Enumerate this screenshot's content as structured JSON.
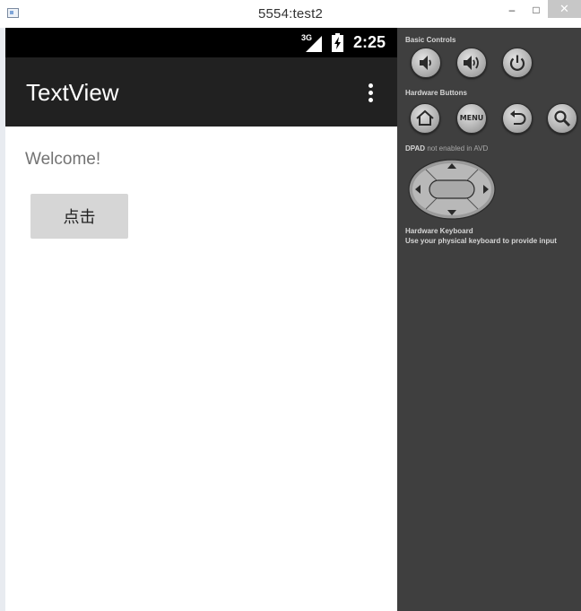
{
  "window": {
    "title": "5554:test2",
    "minimize_glyph": "–",
    "maximize_glyph": "□",
    "close_glyph": "✕"
  },
  "statusbar": {
    "network_label": "3G",
    "time": "2:25"
  },
  "actionbar": {
    "title": "TextView",
    "overflow_icon": "more-vert-icon"
  },
  "content": {
    "welcome_text": "Welcome!",
    "button_label": "点击"
  },
  "panel": {
    "basic_controls_label": "Basic Controls",
    "basic_controls": [
      "volume-down-icon",
      "volume-up-icon",
      "power-icon"
    ],
    "hardware_buttons_label": "Hardware Buttons",
    "hardware_buttons": [
      "home-icon",
      "menu-button",
      "back-icon",
      "search-icon"
    ],
    "menu_label": "MENU",
    "dpad_label": "DPAD",
    "dpad_note": "not enabled in AVD",
    "keyboard_label": "Hardware Keyboard",
    "keyboard_note": "Use your physical keyboard to provide input"
  },
  "colors": {
    "actionbar": "#212121",
    "statusbar": "#000000",
    "panel": "#3f3f3f",
    "button_bg": "#d6d6d6"
  }
}
